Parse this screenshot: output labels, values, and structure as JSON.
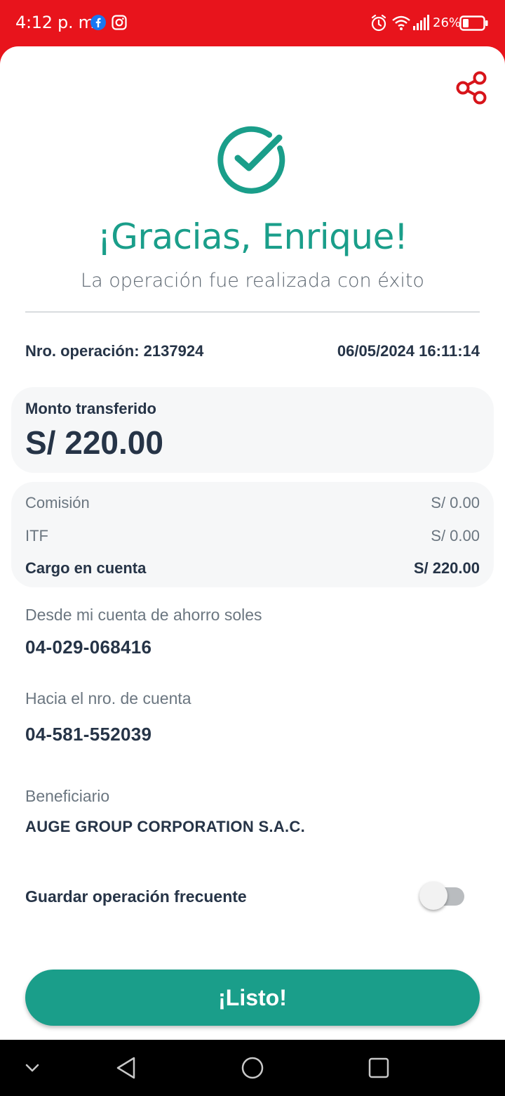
{
  "status_bar": {
    "time": "4:12 p. m.",
    "battery": "26%"
  },
  "header": {
    "title": "¡Gracias, Enrique!",
    "subtitle": "La operación fue realizada con éxito"
  },
  "operation": {
    "number": "Nro. operación: 2137924",
    "datetime": "06/05/2024 16:11:14"
  },
  "amount": {
    "label": "Monto transferido",
    "value": "S/ 220.00"
  },
  "fees": [
    {
      "label": "Comisión",
      "value": "S/ 0.00"
    },
    {
      "label": "ITF",
      "value": "S/ 0.00"
    },
    {
      "label": "Cargo en cuenta",
      "value": "S/ 220.00"
    }
  ],
  "from_account": {
    "label": "Desde mi cuenta de ahorro soles",
    "value": "04-029-068416"
  },
  "to_account": {
    "label": "Hacia el nro. de cuenta",
    "value": "04-581-552039"
  },
  "beneficiary": {
    "label": "Beneficiario",
    "value": "AUGE GROUP CORPORATION S.A.C."
  },
  "save_frequent": {
    "label": "Guardar operación frecuente",
    "enabled": false
  },
  "done_button": "¡Listo!",
  "colors": {
    "brand_red": "#e8141c",
    "success_teal": "#1a9e8a",
    "text_dark": "#263447",
    "text_muted": "#6b7680"
  },
  "icons": [
    "facebook-icon",
    "instagram-icon",
    "alarm-icon",
    "wifi-icon",
    "signal-icon",
    "battery-icon",
    "share-icon",
    "check-circle-icon",
    "nav-down-icon",
    "nav-back-icon",
    "nav-home-icon",
    "nav-recent-icon"
  ]
}
